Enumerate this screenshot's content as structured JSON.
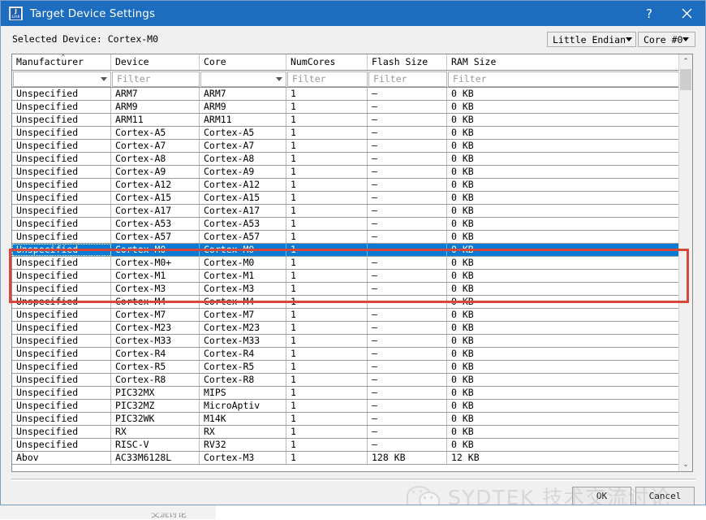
{
  "window": {
    "title": "Target Device Settings",
    "icon": "jlink-icon",
    "icon_top_text": "J",
    "icon_bottom_text": "Link",
    "help_label": "?",
    "close_label": "✕",
    "titlebar_color": "#1c6cc0"
  },
  "selected_device": {
    "label": "Selected Device: Cortex-M0"
  },
  "toolbar": {
    "endian": {
      "value": "Little Endian"
    },
    "core": {
      "value": "Core #0"
    }
  },
  "grid": {
    "columns": [
      {
        "label": "Manufacturer",
        "filter_placeholder": "",
        "filter_type": "dropdown"
      },
      {
        "label": "Device",
        "filter_placeholder": "Filter",
        "filter_type": "text"
      },
      {
        "label": "Core",
        "filter_placeholder": "",
        "filter_type": "dropdown"
      },
      {
        "label": "NumCores",
        "filter_placeholder": "Filter",
        "filter_type": "text"
      },
      {
        "label": "Flash Size",
        "filter_placeholder": "Filter",
        "filter_type": "text"
      },
      {
        "label": "RAM Size",
        "filter_placeholder": "Filter",
        "filter_type": "text"
      }
    ],
    "sort_indicator": "⌃",
    "sorted_column": "Manufacturer",
    "selected_row_index": 12,
    "rows": [
      {
        "manufacturer": "Unspecified",
        "device": "ARM7",
        "core": "ARM7",
        "numcores": "1",
        "flash": "–",
        "ram": "0 KB"
      },
      {
        "manufacturer": "Unspecified",
        "device": "ARM9",
        "core": "ARM9",
        "numcores": "1",
        "flash": "–",
        "ram": "0 KB"
      },
      {
        "manufacturer": "Unspecified",
        "device": "ARM11",
        "core": "ARM11",
        "numcores": "1",
        "flash": "–",
        "ram": "0 KB"
      },
      {
        "manufacturer": "Unspecified",
        "device": "Cortex-A5",
        "core": "Cortex-A5",
        "numcores": "1",
        "flash": "–",
        "ram": "0 KB"
      },
      {
        "manufacturer": "Unspecified",
        "device": "Cortex-A7",
        "core": "Cortex-A7",
        "numcores": "1",
        "flash": "–",
        "ram": "0 KB"
      },
      {
        "manufacturer": "Unspecified",
        "device": "Cortex-A8",
        "core": "Cortex-A8",
        "numcores": "1",
        "flash": "–",
        "ram": "0 KB"
      },
      {
        "manufacturer": "Unspecified",
        "device": "Cortex-A9",
        "core": "Cortex-A9",
        "numcores": "1",
        "flash": "–",
        "ram": "0 KB"
      },
      {
        "manufacturer": "Unspecified",
        "device": "Cortex-A12",
        "core": "Cortex-A12",
        "numcores": "1",
        "flash": "–",
        "ram": "0 KB"
      },
      {
        "manufacturer": "Unspecified",
        "device": "Cortex-A15",
        "core": "Cortex-A15",
        "numcores": "1",
        "flash": "–",
        "ram": "0 KB"
      },
      {
        "manufacturer": "Unspecified",
        "device": "Cortex-A17",
        "core": "Cortex-A17",
        "numcores": "1",
        "flash": "–",
        "ram": "0 KB"
      },
      {
        "manufacturer": "Unspecified",
        "device": "Cortex-A53",
        "core": "Cortex-A53",
        "numcores": "1",
        "flash": "–",
        "ram": "0 KB"
      },
      {
        "manufacturer": "Unspecified",
        "device": "Cortex-A57",
        "core": "Cortex-A57",
        "numcores": "1",
        "flash": "–",
        "ram": "0 KB"
      },
      {
        "manufacturer": "Unspecified",
        "device": "Cortex-M0",
        "core": "Cortex-M0",
        "numcores": "1",
        "flash": "–",
        "ram": "0 KB"
      },
      {
        "manufacturer": "Unspecified",
        "device": "Cortex-M0+",
        "core": "Cortex-M0",
        "numcores": "1",
        "flash": "–",
        "ram": "0 KB"
      },
      {
        "manufacturer": "Unspecified",
        "device": "Cortex-M1",
        "core": "Cortex-M1",
        "numcores": "1",
        "flash": "–",
        "ram": "0 KB"
      },
      {
        "manufacturer": "Unspecified",
        "device": "Cortex-M3",
        "core": "Cortex-M3",
        "numcores": "1",
        "flash": "–",
        "ram": "0 KB"
      },
      {
        "manufacturer": "Unspecified",
        "device": "Cortex-M4",
        "core": "Cortex-M4",
        "numcores": "1",
        "flash": "–",
        "ram": "0 KB"
      },
      {
        "manufacturer": "Unspecified",
        "device": "Cortex-M7",
        "core": "Cortex-M7",
        "numcores": "1",
        "flash": "–",
        "ram": "0 KB"
      },
      {
        "manufacturer": "Unspecified",
        "device": "Cortex-M23",
        "core": "Cortex-M23",
        "numcores": "1",
        "flash": "–",
        "ram": "0 KB"
      },
      {
        "manufacturer": "Unspecified",
        "device": "Cortex-M33",
        "core": "Cortex-M33",
        "numcores": "1",
        "flash": "–",
        "ram": "0 KB"
      },
      {
        "manufacturer": "Unspecified",
        "device": "Cortex-R4",
        "core": "Cortex-R4",
        "numcores": "1",
        "flash": "–",
        "ram": "0 KB"
      },
      {
        "manufacturer": "Unspecified",
        "device": "Cortex-R5",
        "core": "Cortex-R5",
        "numcores": "1",
        "flash": "–",
        "ram": "0 KB"
      },
      {
        "manufacturer": "Unspecified",
        "device": "Cortex-R8",
        "core": "Cortex-R8",
        "numcores": "1",
        "flash": "–",
        "ram": "0 KB"
      },
      {
        "manufacturer": "Unspecified",
        "device": "PIC32MX",
        "core": "MIPS",
        "numcores": "1",
        "flash": "–",
        "ram": "0 KB"
      },
      {
        "manufacturer": "Unspecified",
        "device": "PIC32MZ",
        "core": "MicroAptiv",
        "numcores": "1",
        "flash": "–",
        "ram": "0 KB"
      },
      {
        "manufacturer": "Unspecified",
        "device": "PIC32WK",
        "core": "M14K",
        "numcores": "1",
        "flash": "–",
        "ram": "0 KB"
      },
      {
        "manufacturer": "Unspecified",
        "device": "RX",
        "core": "RX",
        "numcores": "1",
        "flash": "–",
        "ram": "0 KB"
      },
      {
        "manufacturer": "Unspecified",
        "device": "RISC-V",
        "core": "RV32",
        "numcores": "1",
        "flash": "–",
        "ram": "0 KB"
      },
      {
        "manufacturer": "Abov",
        "device": "AC33M6128L",
        "core": "Cortex-M3",
        "numcores": "1",
        "flash": "128 KB",
        "ram": "12 KB"
      }
    ]
  },
  "scrollbar": {
    "up_arrow": "⌃",
    "down_arrow": "⌄"
  },
  "footer": {
    "ok_label": "OK",
    "cancel_label": "Cancel"
  },
  "annotation": {
    "highlight_color": "#d9463a",
    "note": "red-box around Cortex-M0 / M0+ / M1 / M3 rows"
  },
  "watermark": {
    "text": "SYDTEK 技术交流讨论",
    "color": "#b4b4b4"
  },
  "background": {
    "partial_text": "交流讨论"
  }
}
